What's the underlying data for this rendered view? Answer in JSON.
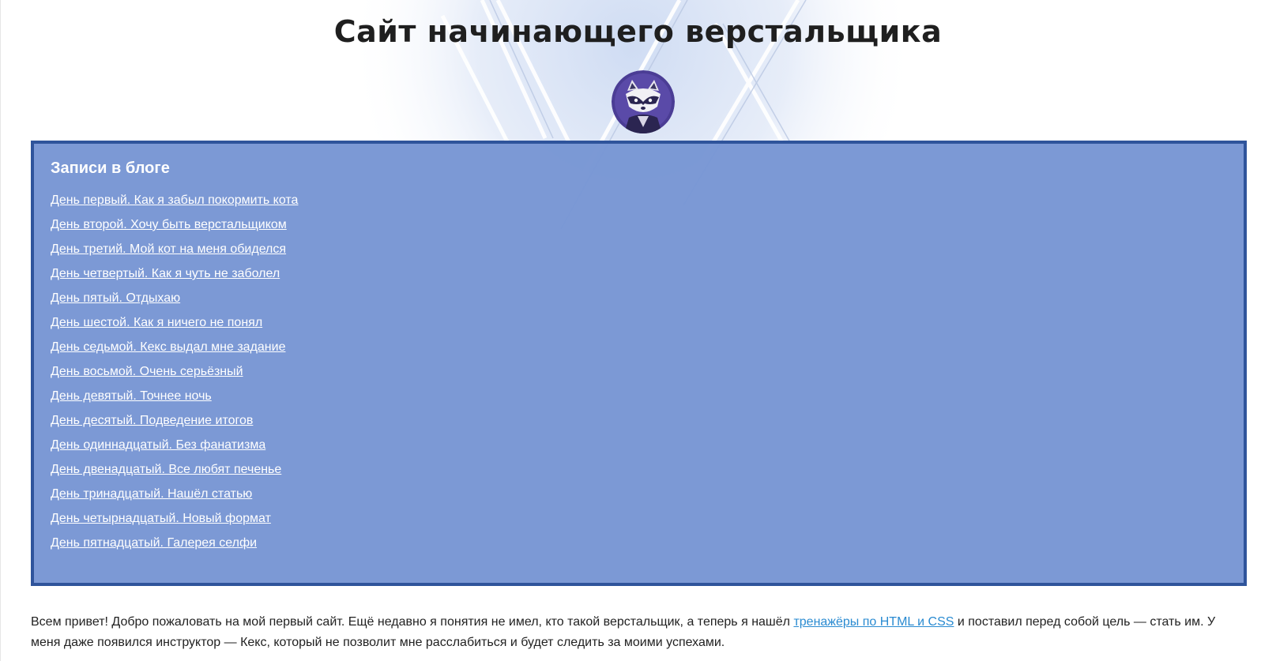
{
  "header": {
    "title": "Сайт начинающего верстальщика"
  },
  "blog": {
    "heading": "Записи в блоге",
    "entries": [
      "День первый. Как я забыл покормить кота",
      "День второй. Хочу быть верстальщиком",
      "День третий. Мой кот на меня обиделся",
      "День четвертый. Как я чуть не заболел",
      "День пятый. Отдыхаю",
      "День шестой. Как я ничего не понял",
      "День седьмой. Кекс выдал мне задание",
      "День восьмой. Очень серьёзный",
      "День девятый. Точнее ночь",
      "День десятый. Подведение итогов",
      "День одиннадцатый. Без фанатизма",
      "День двенадцатый. Все любят печенье",
      "День тринадцатый. Нашёл статью",
      "День четырнадцатый. Новый формат",
      "День пятнадцатый. Галерея селфи"
    ]
  },
  "intro": {
    "before_link": "Всем привет! Добро пожаловать на мой первый сайт. Ещё недавно я понятия не имел, кто такой верстальщик, а теперь я нашёл ",
    "link_text": "тренажёры по HTML и CSS",
    "after_link": " и поставил перед собой цель — стать им. У меня даже появился инструктор — Кекс, который не позволит мне расслабиться и будет следить за моими успехами."
  },
  "colors": {
    "panel_background": "#7b97d4",
    "panel_border": "#2f549b",
    "link_in_text": "#2a8bd1",
    "avatar_background": "#4b3d95"
  },
  "icons": {
    "avatar": "raccoon-avatar-icon"
  }
}
